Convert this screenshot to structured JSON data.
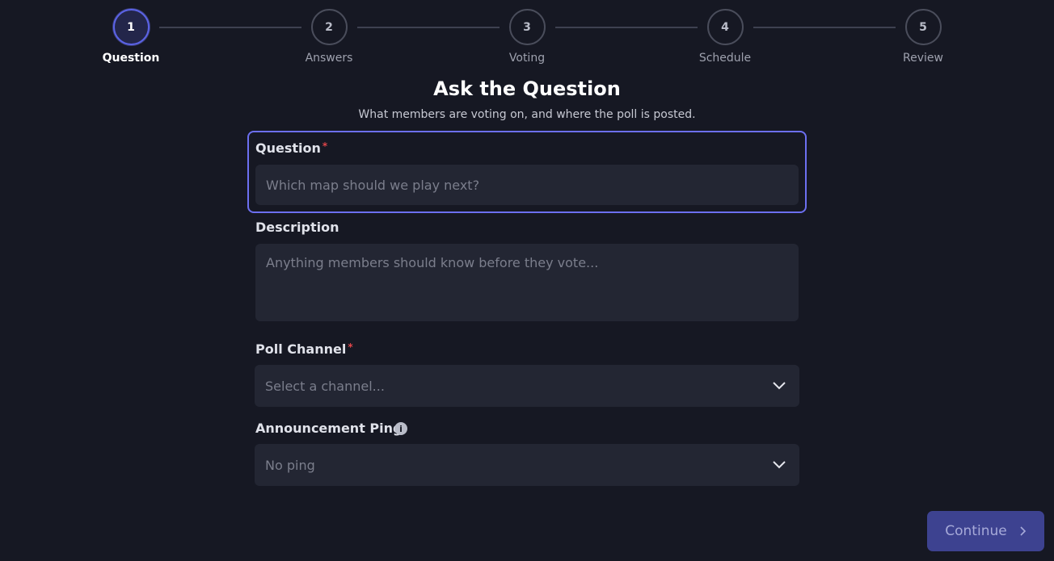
{
  "stepper": {
    "steps": [
      {
        "number": "1",
        "label": "Question"
      },
      {
        "number": "2",
        "label": "Answers"
      },
      {
        "number": "3",
        "label": "Voting"
      },
      {
        "number": "4",
        "label": "Schedule"
      },
      {
        "number": "5",
        "label": "Review"
      }
    ],
    "active_step": "1"
  },
  "header": {
    "title": "Ask the Question",
    "subtitle": "What members are voting on, and where the poll is posted."
  },
  "form": {
    "question": {
      "label": "Question",
      "required_mark": "*",
      "value": "",
      "placeholder": "Which map should we play next?"
    },
    "description": {
      "label": "Description",
      "value": "",
      "placeholder": "Anything members should know before they vote..."
    },
    "poll_channel": {
      "label": "Poll Channel",
      "required_mark": "*",
      "value": "Select a channel..."
    },
    "announcement_ping": {
      "label": "Announcement Ping",
      "info_icon": "i",
      "value": "No ping"
    }
  },
  "footer": {
    "continue_label": "Continue",
    "continue_icon": "chevron-right-icon"
  },
  "colors": {
    "accent": "#5b63e6",
    "background": "#161823",
    "input_bg": "#232633",
    "required": "#e0464a",
    "button_bg": "#3d4290"
  }
}
